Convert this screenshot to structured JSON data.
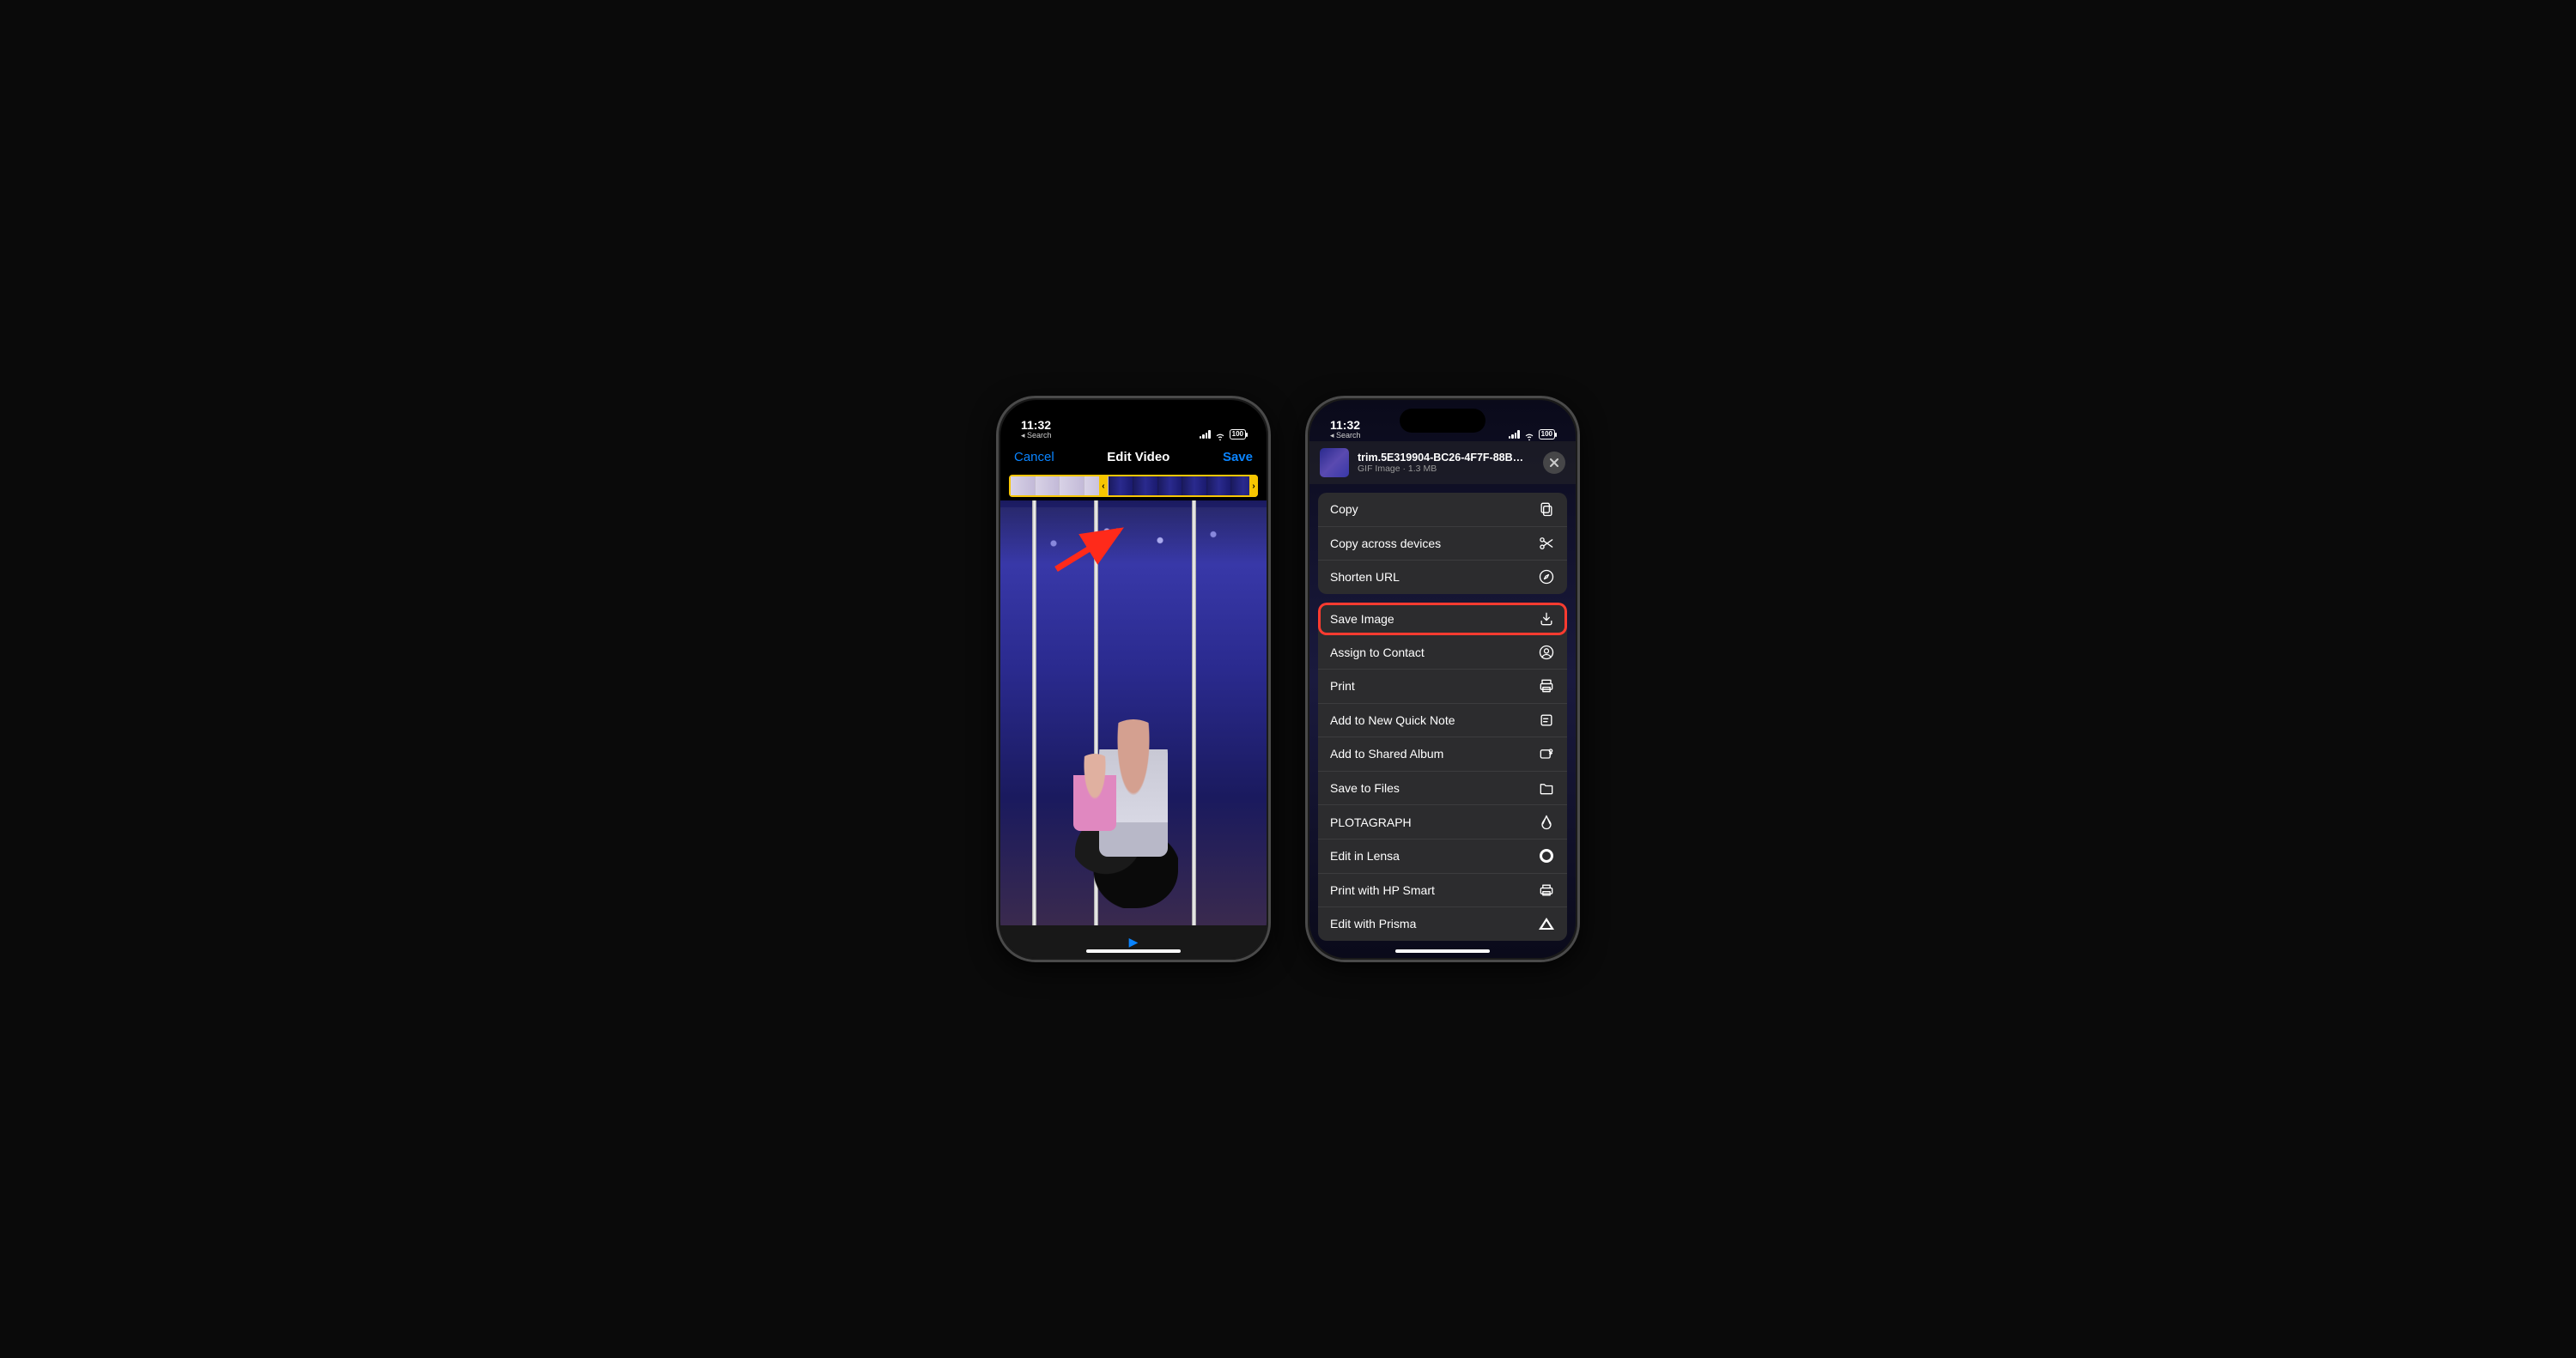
{
  "phone1": {
    "status": {
      "time": "11:32",
      "back": "Search",
      "battery": "100"
    },
    "nav": {
      "cancel": "Cancel",
      "title": "Edit Video",
      "save": "Save"
    }
  },
  "phone2": {
    "status": {
      "time": "11:32",
      "back": "Search",
      "battery": "100"
    },
    "header": {
      "filename": "trim.5E319904-BC26-4F7F-88B…",
      "meta": "GIF Image · 1.3 MB"
    },
    "group1": [
      {
        "label": "Copy",
        "icon": "copy"
      },
      {
        "label": "Copy across devices",
        "icon": "scissors"
      },
      {
        "label": "Shorten URL",
        "icon": "compass"
      }
    ],
    "group2": [
      {
        "label": "Save Image",
        "icon": "download",
        "highlighted": true
      },
      {
        "label": "Assign to Contact",
        "icon": "contact"
      },
      {
        "label": "Print",
        "icon": "print"
      },
      {
        "label": "Add to New Quick Note",
        "icon": "note"
      },
      {
        "label": "Add to Shared Album",
        "icon": "shared-album"
      },
      {
        "label": "Save to Files",
        "icon": "folder"
      },
      {
        "label": "PLOTAGRAPH",
        "icon": "plotagraph"
      },
      {
        "label": "Edit in Lensa",
        "icon": "lensa"
      },
      {
        "label": "Print with HP Smart",
        "icon": "hp"
      },
      {
        "label": "Edit with Prisma",
        "icon": "prisma"
      }
    ]
  }
}
